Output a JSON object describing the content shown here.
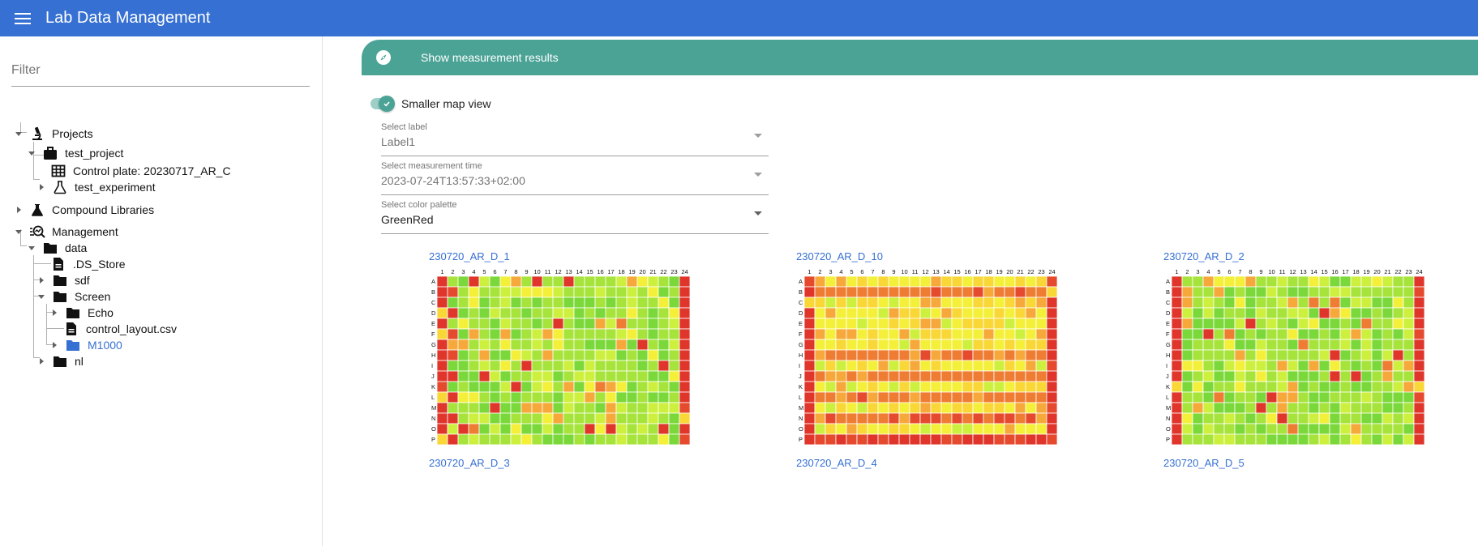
{
  "app": {
    "title": "Lab Data Management"
  },
  "sidebar": {
    "filter_placeholder": "Filter",
    "tree": [
      {
        "label": "Projects",
        "icon": "microscope-icon",
        "expanded": true
      },
      {
        "label": "test_project",
        "icon": "briefcase-icon",
        "expanded": true
      },
      {
        "label": "Control plate: 20230717_AR_C",
        "icon": "grid-icon"
      },
      {
        "label": "test_experiment",
        "icon": "flask-icon",
        "expanded": false
      },
      {
        "label": "Compound Libraries",
        "icon": "flask-filled-icon",
        "expanded": false
      },
      {
        "label": "Management",
        "icon": "manage-search-icon",
        "expanded": true
      },
      {
        "label": "data",
        "icon": "folder-icon",
        "expanded": true
      },
      {
        "label": ".DS_Store",
        "icon": "file-icon"
      },
      {
        "label": "sdf",
        "icon": "folder-icon",
        "expanded": false
      },
      {
        "label": "Screen",
        "icon": "folder-icon",
        "expanded": true
      },
      {
        "label": "Echo",
        "icon": "folder-icon",
        "expanded": false
      },
      {
        "label": "control_layout.csv",
        "icon": "file-icon"
      },
      {
        "label": "M1000",
        "icon": "folder-icon",
        "expanded": false,
        "selected": true
      },
      {
        "label": "nl",
        "icon": "folder-icon",
        "expanded": false
      }
    ]
  },
  "main": {
    "header_title": "Show measurement results",
    "toggle": {
      "label": "Smaller map view",
      "checked": true
    },
    "selects": [
      {
        "label": "Select label",
        "value": "Label1",
        "disabled": true
      },
      {
        "label": "Select measurement time",
        "value": "2023-07-24T13:57:33+02:00",
        "disabled": true
      },
      {
        "label": "Select color palette",
        "value": "GreenRed",
        "disabled": false
      }
    ],
    "plates": [
      {
        "name": "230720_AR_D_1"
      },
      {
        "name": "230720_AR_D_10"
      },
      {
        "name": "230720_AR_D_2"
      }
    ],
    "plates_next_row": [
      "230720_AR_D_3",
      "230720_AR_D_4",
      "230720_AR_D_5"
    ],
    "plate_rows": [
      "A",
      "B",
      "C",
      "D",
      "E",
      "F",
      "G",
      "H",
      "I",
      "J",
      "K",
      "L",
      "M",
      "N",
      "O",
      "P"
    ],
    "plate_cols": [
      "1",
      "2",
      "3",
      "4",
      "5",
      "6",
      "7",
      "8",
      "9",
      "10",
      "11",
      "12",
      "13",
      "14",
      "15",
      "16",
      "17",
      "18",
      "19",
      "20",
      "21",
      "22",
      "23",
      "24"
    ]
  },
  "colors": {
    "appbar": "#3670d3",
    "teal": "#4ba396",
    "link": "#3670d3",
    "palette": [
      "#a6e33b",
      "#7bd83a",
      "#cdf03e",
      "#f4f03a",
      "#f9d736",
      "#f6a93a",
      "#ef7c33",
      "#e64a2e",
      "#e0352b"
    ]
  }
}
